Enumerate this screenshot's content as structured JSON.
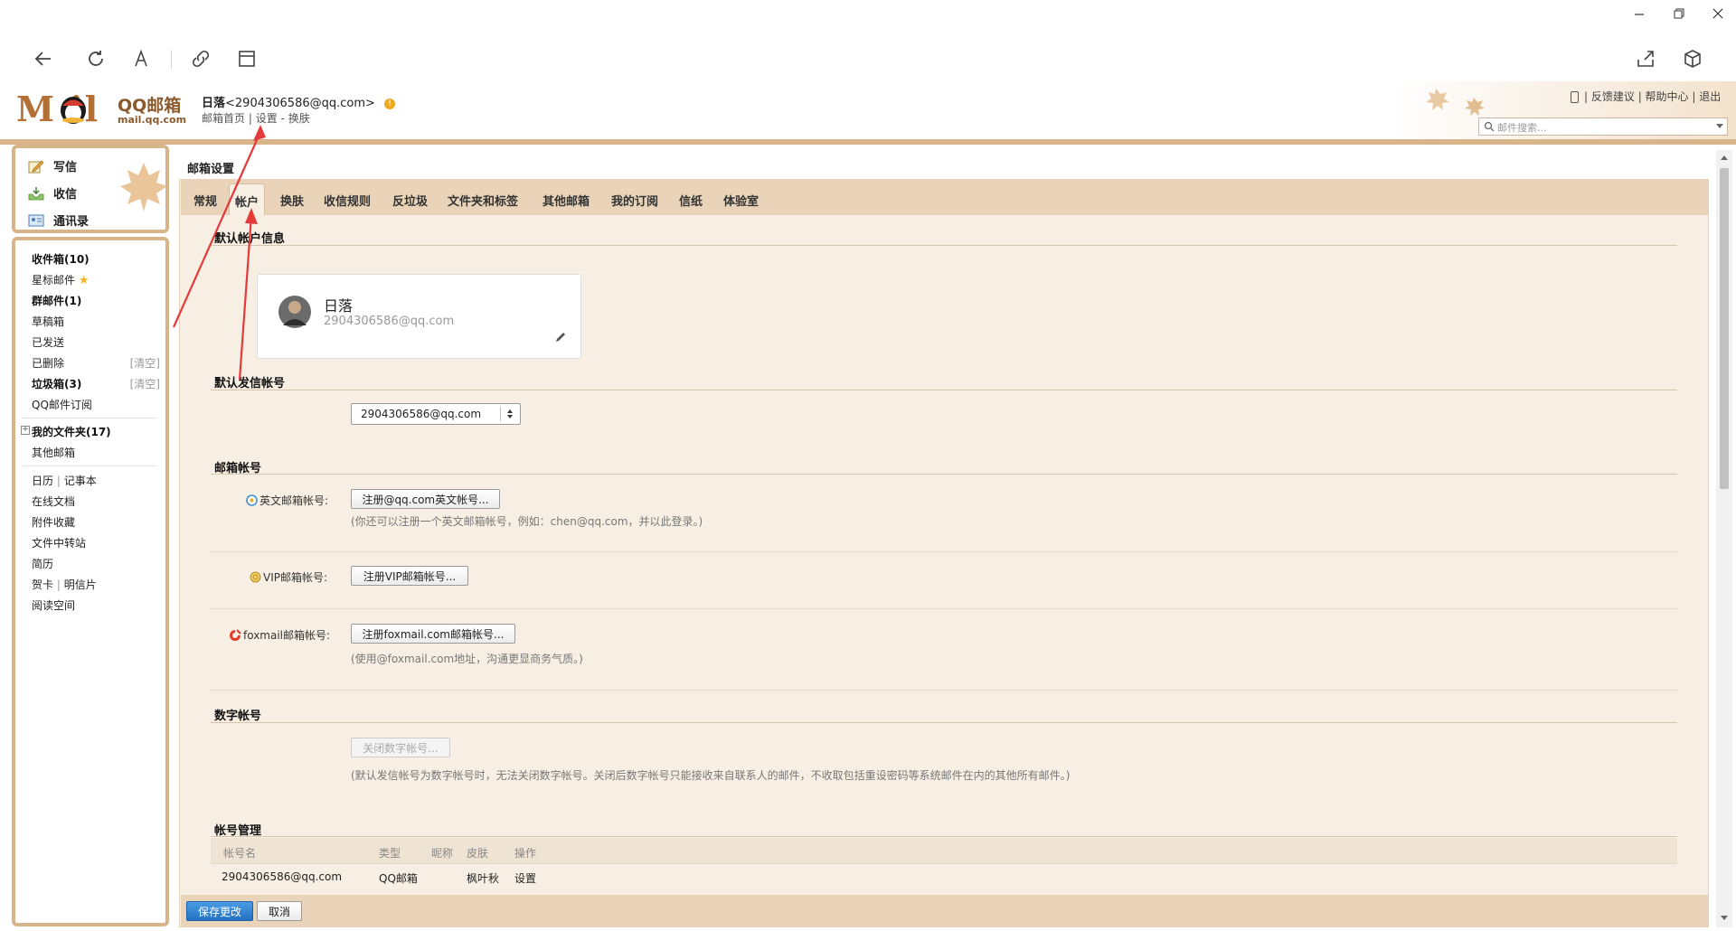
{
  "header": {
    "logo_text": "M  il",
    "logo_qq": "QQ邮箱",
    "logo_domain": "mail.qq.com",
    "user_name": "日落",
    "user_email": "<2904306586@qq.com>",
    "nav_home": "邮箱首页",
    "nav_sep": "|",
    "nav_settings": "设置",
    "nav_dash": "-",
    "nav_skin": "换肤",
    "top_links": [
      "反馈建议",
      "帮助中心",
      "退出"
    ],
    "search_placeholder": "邮件搜索..."
  },
  "sidebar": {
    "compose": "写信",
    "inbox_action": "收信",
    "contacts": "通讯录",
    "folders": [
      {
        "label": "收件箱(10)"
      },
      {
        "label": "星标邮件"
      },
      {
        "label": "群邮件(1)"
      },
      {
        "label": "草稿箱"
      },
      {
        "label": "已发送"
      },
      {
        "label": "已删除",
        "action": "[清空]"
      },
      {
        "label": "垃圾箱(3)",
        "action": "[清空]"
      },
      {
        "label": "QQ邮件订阅"
      }
    ],
    "my_folders": "我的文件夹(17)",
    "other_mail": "其他邮箱",
    "tools": [
      {
        "label": "日历",
        "extra": "记事本"
      },
      {
        "label": "在线文档"
      },
      {
        "label": "附件收藏"
      },
      {
        "label": "文件中转站"
      },
      {
        "label": "简历"
      },
      {
        "label": "贺卡",
        "extra": "明信片"
      },
      {
        "label": "阅读空间"
      }
    ]
  },
  "settings": {
    "title": "邮箱设置",
    "tabs": [
      "常规",
      "帐户",
      "换肤",
      "收信规则",
      "反垃圾",
      "文件夹和标签",
      "其他邮箱",
      "我的订阅",
      "信纸",
      "体验室"
    ],
    "active_tab": "帐户",
    "default_account_section": "默认帐户信息",
    "profile_name": "日落",
    "profile_email": "2904306586@qq.com",
    "default_sender_section": "默认发信帐号",
    "default_sender_value": "2904306586@qq.com",
    "mail_accounts_section": "邮箱帐号",
    "english_label": "英文邮箱帐号:",
    "english_button": "注册@qq.com英文帐号...",
    "english_hint": "(你还可以注册一个英文邮箱帐号，例如：chen@qq.com，并以此登录。)",
    "vip_label": "VIP邮箱帐号:",
    "vip_button": "注册VIP邮箱帐号...",
    "foxmail_label": "foxmail邮箱帐号:",
    "foxmail_button": "注册foxmail.com邮箱帐号...",
    "foxmail_hint": "(使用@foxmail.com地址，沟通更显商务气质。)",
    "digital_section": "数字帐号",
    "digital_button": "关闭数字帐号...",
    "digital_hint": "(默认发信帐号为数字帐号时，无法关闭数字帐号。关闭后数字帐号只能接收来自联系人的邮件，不收取包括重设密码等系统邮件在内的其他所有邮件。)",
    "manage_section": "帐号管理",
    "table_headers": [
      "帐号名",
      "类型",
      "昵称",
      "皮肤",
      "操作"
    ],
    "table_rows": [
      [
        "2904306586@qq.com",
        "QQ邮箱",
        "",
        "枫叶秋",
        "设置"
      ]
    ],
    "save_button": "保存更改",
    "cancel_button": "取消"
  },
  "colors": {
    "accent": "#d8b48a",
    "tab_bar": "#ead4b9",
    "content_bg": "#f7efe4",
    "primary_button": "#2f82d3",
    "annotation": "#e43a3a"
  }
}
